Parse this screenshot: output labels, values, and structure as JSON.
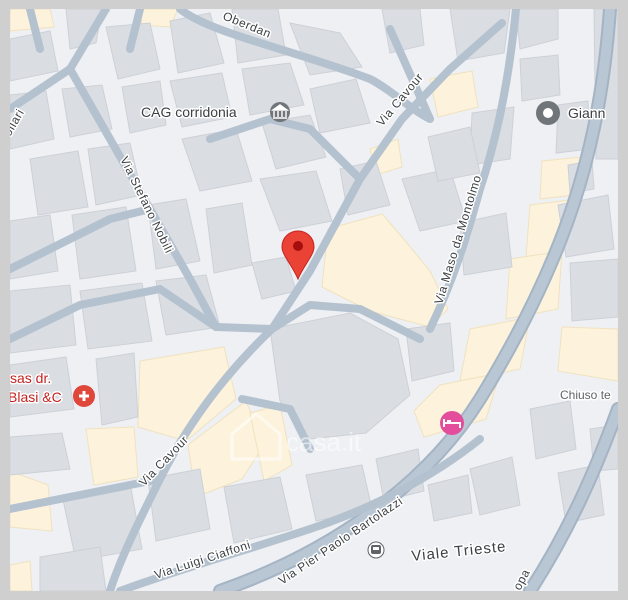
{
  "colors": {
    "background": "#eef0f3",
    "building": "#dadde2",
    "road": "#aebccb",
    "road_outline": "#a4b4c4",
    "highlight_area": "#fdf3dc",
    "marker": "#ea4335",
    "poi_grey": "#70757a",
    "poi_red": "#e0473b",
    "hotel": "#e34d9b",
    "frame": "#cfcfcf"
  },
  "streets": {
    "oberdan": "Oberdan",
    "vallari": "ollari",
    "stefano_nobili": "Via Stefano Nobili",
    "cavour_north": "Via Cavour",
    "maso_da_montolmo": "Via Maso da Montolmo",
    "cavour_south": "Via Cavour",
    "luigi_ciaffoni": "Via Luigi Ciaffoni",
    "pier_paolo_bartolazzi": "Via Pier Paolo Bartolazzi",
    "viale_trieste": "Viale Trieste",
    "opa": "opa"
  },
  "places": {
    "cag_corridonia": "CAG corridonia",
    "gianni": "Giann",
    "pharmacy_line1": "sas dr.",
    "pharmacy_line2": "Blasi &C",
    "chiuso": "Chiuso te"
  },
  "icons": {
    "location_marker": "red-map-pin",
    "cag": "museum-icon",
    "gianni": "place-pin-icon",
    "pharmacy": "pharmacy-icon",
    "hotel": "hotel-bed-icon",
    "bus": "bus-icon"
  },
  "watermark": "casa.it"
}
